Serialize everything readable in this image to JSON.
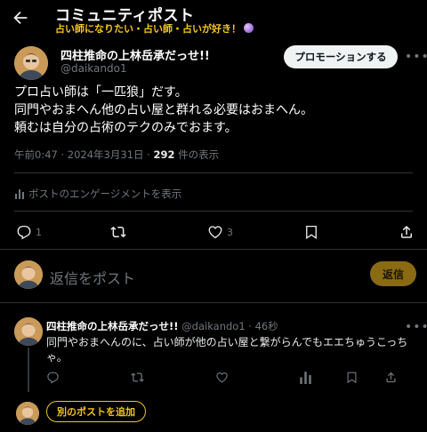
{
  "header": {
    "title": "コミュニティポスト",
    "subtitle": "占い師になりたい・占い師・占いが好き！"
  },
  "post": {
    "author_name": "四柱推命の上林岳承だっせ!!",
    "author_handle": "@daikando1",
    "promote_label": "プロモーションする",
    "lines": [
      "プロ占い師は「一匹狼」だす。",
      "同門やおまへん他の占い屋と群れる必要はおまへん。",
      "頼むは自分の占術のテクのみでおます。"
    ],
    "time": "午前0:47 · 2024年3月31日 · ",
    "views": "292",
    "views_suffix": " 件の表示",
    "analytics_label": "ポストのエンゲージメントを表示",
    "reply_count": "1",
    "like_count": "3"
  },
  "compose": {
    "placeholder": "返信をポスト",
    "reply_button": "返信"
  },
  "reply": {
    "author_name": "四柱推命の上林岳承だっせ!!",
    "handle_time": " @daikando1 · 46秒",
    "text": "同門やおまへんのに、占い師が他の占い屋と繋がらんでもエエちゅうこっちゃ。"
  },
  "add_post_label": "別のポストを追加",
  "colors": {
    "accent": "#f5c518",
    "background": "#000000",
    "divider": "#2f3336"
  }
}
